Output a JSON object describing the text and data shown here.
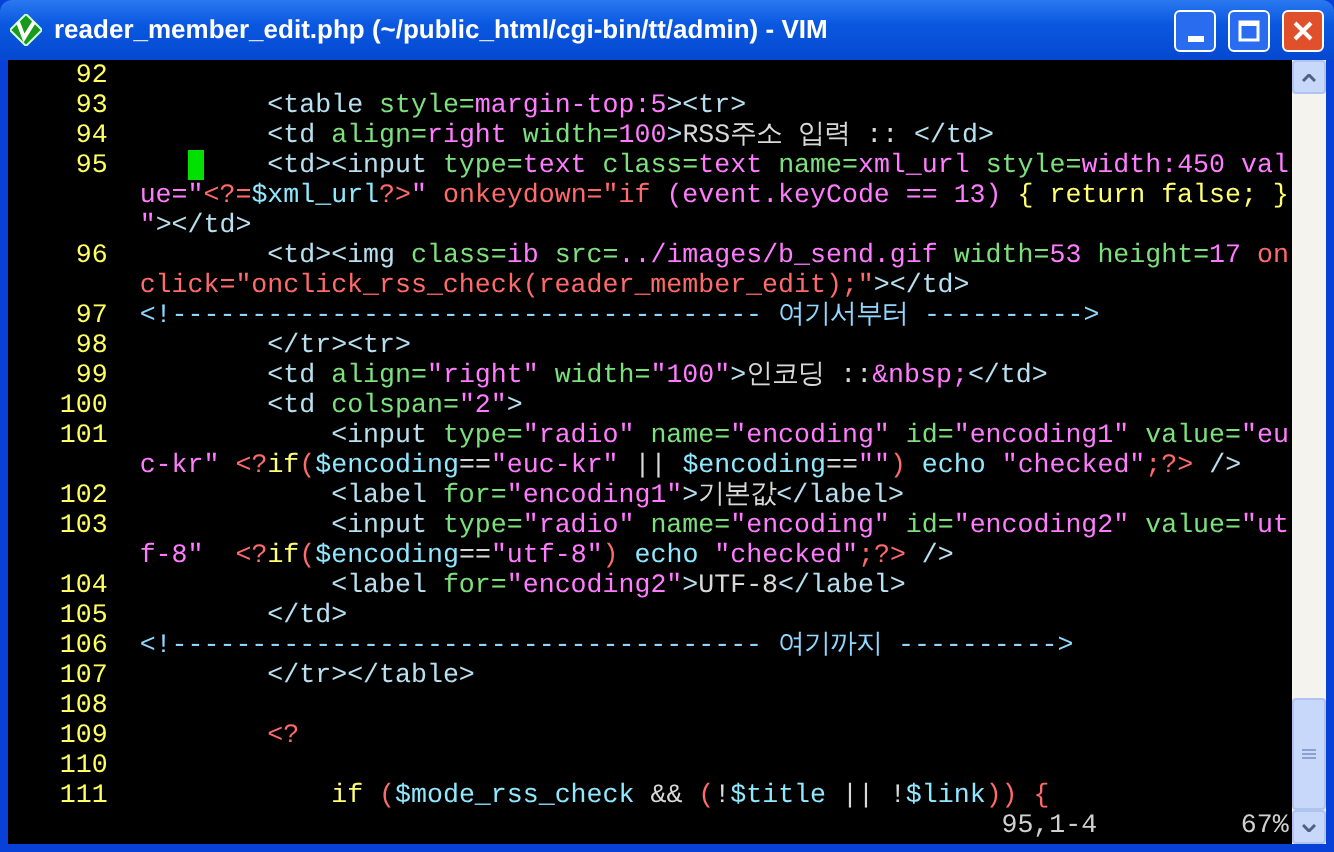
{
  "window": {
    "title": "reader_member_edit.php (~/public_html/cgi-bin/tt/admin) - VIM"
  },
  "editor": {
    "lines": [
      {
        "number": "92",
        "cursor": false
      },
      {
        "number": "93",
        "cursor": false,
        "rows": [
          {
            "segments": [
              {
                "kind": "tag",
                "text": "        <table "
              },
              {
                "kind": "attr",
                "text": "style="
              },
              {
                "kind": "val",
                "text": "margin-top:5"
              },
              {
                "kind": "tag",
                "text": "><tr>"
              }
            ]
          }
        ]
      },
      {
        "number": "94",
        "cursor": false,
        "rows": [
          {
            "segments": [
              {
                "kind": "tag",
                "text": "        <td "
              },
              {
                "kind": "attr",
                "text": "align="
              },
              {
                "kind": "val",
                "text": "right "
              },
              {
                "kind": "attr",
                "text": "width="
              },
              {
                "kind": "val",
                "text": "100"
              },
              {
                "kind": "tag",
                "text": ">"
              },
              {
                "kind": "text",
                "text": "RSS주소 입력 :: "
              },
              {
                "kind": "tag",
                "text": "</td>"
              }
            ]
          }
        ]
      },
      {
        "number": "95",
        "cursor": true,
        "rows": [
          {
            "segments": [
              {
                "kind": "tag",
                "text": "        <td><input "
              },
              {
                "kind": "attr",
                "text": "type="
              },
              {
                "kind": "val",
                "text": "text "
              },
              {
                "kind": "attr",
                "text": "class="
              },
              {
                "kind": "val",
                "text": "text "
              },
              {
                "kind": "attr",
                "text": "name="
              },
              {
                "kind": "val",
                "text": "xml_url "
              },
              {
                "kind": "attr",
                "text": "style="
              },
              {
                "kind": "val",
                "text": "width:450 val"
              }
            ]
          },
          {
            "segments": [
              {
                "kind": "val",
                "text": "ue=\""
              },
              {
                "kind": "php",
                "text": "<?="
              },
              {
                "kind": "var",
                "text": "$xml_url"
              },
              {
                "kind": "php",
                "text": "?>"
              },
              {
                "kind": "val",
                "text": "\" "
              },
              {
                "kind": "event",
                "text": "onkeydown=\"if "
              },
              {
                "kind": "val",
                "text": "(event.keyCode == 13) "
              },
              {
                "kind": "kw",
                "text": "{ return false; }"
              }
            ]
          },
          {
            "segments": [
              {
                "kind": "val",
                "text": "\""
              },
              {
                "kind": "tag",
                "text": "></td>"
              }
            ]
          }
        ]
      },
      {
        "number": "96",
        "cursor": false,
        "rows": [
          {
            "segments": [
              {
                "kind": "tag",
                "text": "        <td><img "
              },
              {
                "kind": "attr",
                "text": "class="
              },
              {
                "kind": "val",
                "text": "ib "
              },
              {
                "kind": "attr",
                "text": "src="
              },
              {
                "kind": "val",
                "text": "../images/b_send.gif "
              },
              {
                "kind": "attr",
                "text": "width="
              },
              {
                "kind": "val",
                "text": "53 "
              },
              {
                "kind": "attr",
                "text": "height="
              },
              {
                "kind": "val",
                "text": "17 "
              },
              {
                "kind": "event",
                "text": "on"
              }
            ]
          },
          {
            "segments": [
              {
                "kind": "event",
                "text": "click=\"onclick_rss_check(reader_member_edit);\""
              },
              {
                "kind": "tag",
                "text": "></td>"
              }
            ]
          }
        ]
      },
      {
        "number": "97",
        "cursor": false,
        "rows": [
          {
            "segments": [
              {
                "kind": "cmt",
                "text": "<!------------------------------------- 여기서부터 ---------->"
              }
            ]
          }
        ]
      },
      {
        "number": "98",
        "cursor": false,
        "rows": [
          {
            "segments": [
              {
                "kind": "tag",
                "text": "        </tr><tr>"
              }
            ]
          }
        ]
      },
      {
        "number": "99",
        "cursor": false,
        "rows": [
          {
            "segments": [
              {
                "kind": "tag",
                "text": "        <td "
              },
              {
                "kind": "attr",
                "text": "align="
              },
              {
                "kind": "val",
                "text": "\"right\" "
              },
              {
                "kind": "attr",
                "text": "width="
              },
              {
                "kind": "val",
                "text": "\"100\""
              },
              {
                "kind": "tag",
                "text": ">"
              },
              {
                "kind": "text",
                "text": "인코딩 ::"
              },
              {
                "kind": "val",
                "text": "&nbsp;"
              },
              {
                "kind": "tag",
                "text": "</td>"
              }
            ]
          }
        ]
      },
      {
        "number": "100",
        "cursor": false,
        "rows": [
          {
            "segments": [
              {
                "kind": "tag",
                "text": "        <td "
              },
              {
                "kind": "attr",
                "text": "colspan="
              },
              {
                "kind": "val",
                "text": "\"2\""
              },
              {
                "kind": "tag",
                "text": ">"
              }
            ]
          }
        ]
      },
      {
        "number": "101",
        "cursor": false,
        "rows": [
          {
            "segments": [
              {
                "kind": "tag",
                "text": "            <input "
              },
              {
                "kind": "attr",
                "text": "type="
              },
              {
                "kind": "val",
                "text": "\"radio\" "
              },
              {
                "kind": "attr",
                "text": "name="
              },
              {
                "kind": "val",
                "text": "\"encoding\" "
              },
              {
                "kind": "attr",
                "text": "id="
              },
              {
                "kind": "val",
                "text": "\"encoding1\" "
              },
              {
                "kind": "attr",
                "text": "value="
              },
              {
                "kind": "val",
                "text": "\"eu"
              }
            ]
          },
          {
            "segments": [
              {
                "kind": "val",
                "text": "c-kr\" "
              },
              {
                "kind": "php",
                "text": "<?"
              },
              {
                "kind": "kw",
                "text": "if"
              },
              {
                "kind": "php",
                "text": "("
              },
              {
                "kind": "var",
                "text": "$encoding"
              },
              {
                "kind": "text",
                "text": "=="
              },
              {
                "kind": "val",
                "text": "\"euc-kr\""
              },
              {
                "kind": "text",
                "text": " || "
              },
              {
                "kind": "var",
                "text": "$encoding"
              },
              {
                "kind": "text",
                "text": "=="
              },
              {
                "kind": "val",
                "text": "\"\""
              },
              {
                "kind": "php",
                "text": ")"
              },
              {
                "kind": "echo",
                "text": " echo "
              },
              {
                "kind": "val",
                "text": "\"checked\""
              },
              {
                "kind": "php",
                "text": ";?>"
              },
              {
                "kind": "tag",
                "text": " />"
              }
            ]
          }
        ]
      },
      {
        "number": "102",
        "cursor": false,
        "rows": [
          {
            "segments": [
              {
                "kind": "tag",
                "text": "            <label "
              },
              {
                "kind": "attr",
                "text": "for="
              },
              {
                "kind": "val",
                "text": "\"encoding1\""
              },
              {
                "kind": "tag",
                "text": ">"
              },
              {
                "kind": "text",
                "text": "기본값"
              },
              {
                "kind": "tag",
                "text": "</label>"
              }
            ]
          }
        ]
      },
      {
        "number": "103",
        "cursor": false,
        "rows": [
          {
            "segments": [
              {
                "kind": "tag",
                "text": "            <input "
              },
              {
                "kind": "attr",
                "text": "type="
              },
              {
                "kind": "val",
                "text": "\"radio\" "
              },
              {
                "kind": "attr",
                "text": "name="
              },
              {
                "kind": "val",
                "text": "\"encoding\" "
              },
              {
                "kind": "attr",
                "text": "id="
              },
              {
                "kind": "val",
                "text": "\"encoding2\" "
              },
              {
                "kind": "attr",
                "text": "value="
              },
              {
                "kind": "val",
                "text": "\"ut"
              }
            ]
          },
          {
            "segments": [
              {
                "kind": "val",
                "text": "f-8\"  "
              },
              {
                "kind": "php",
                "text": "<?"
              },
              {
                "kind": "kw",
                "text": "if"
              },
              {
                "kind": "php",
                "text": "("
              },
              {
                "kind": "var",
                "text": "$encoding"
              },
              {
                "kind": "text",
                "text": "=="
              },
              {
                "kind": "val",
                "text": "\"utf-8\""
              },
              {
                "kind": "php",
                "text": ")"
              },
              {
                "kind": "echo",
                "text": " echo "
              },
              {
                "kind": "val",
                "text": "\"checked\""
              },
              {
                "kind": "php",
                "text": ";?>"
              },
              {
                "kind": "tag",
                "text": " />"
              }
            ]
          }
        ]
      },
      {
        "number": "104",
        "cursor": false,
        "rows": [
          {
            "segments": [
              {
                "kind": "tag",
                "text": "            <label "
              },
              {
                "kind": "attr",
                "text": "for="
              },
              {
                "kind": "val",
                "text": "\"encoding2\""
              },
              {
                "kind": "tag",
                "text": ">"
              },
              {
                "kind": "text",
                "text": "UTF-8"
              },
              {
                "kind": "tag",
                "text": "</label>"
              }
            ]
          }
        ]
      },
      {
        "number": "105",
        "cursor": false,
        "rows": [
          {
            "segments": [
              {
                "kind": "tag",
                "text": "        </td>"
              }
            ]
          }
        ]
      },
      {
        "number": "106",
        "cursor": false,
        "rows": [
          {
            "segments": [
              {
                "kind": "cmt",
                "text": "<!------------------------------------- 여기까지 ---------->"
              }
            ]
          }
        ]
      },
      {
        "number": "107",
        "cursor": false,
        "rows": [
          {
            "segments": [
              {
                "kind": "tag",
                "text": "        </tr></table>"
              }
            ]
          }
        ]
      },
      {
        "number": "108",
        "cursor": false
      },
      {
        "number": "109",
        "cursor": false,
        "rows": [
          {
            "segments": [
              {
                "kind": "php",
                "text": "        <?"
              }
            ]
          }
        ]
      },
      {
        "number": "110",
        "cursor": false
      },
      {
        "number": "111",
        "cursor": false,
        "rows": [
          {
            "segments": [
              {
                "kind": "kw",
                "text": "            if "
              },
              {
                "kind": "php",
                "text": "("
              },
              {
                "kind": "var",
                "text": "$mode_rss_check"
              },
              {
                "kind": "text",
                "text": " && "
              },
              {
                "kind": "php",
                "text": "("
              },
              {
                "kind": "text",
                "text": "!"
              },
              {
                "kind": "var",
                "text": "$title"
              },
              {
                "kind": "text",
                "text": " || !"
              },
              {
                "kind": "var",
                "text": "$link"
              },
              {
                "kind": "php",
                "text": ")) {"
              }
            ]
          }
        ]
      }
    ]
  },
  "status_bar": {
    "position": "95,1-4",
    "percent": "67%"
  }
}
